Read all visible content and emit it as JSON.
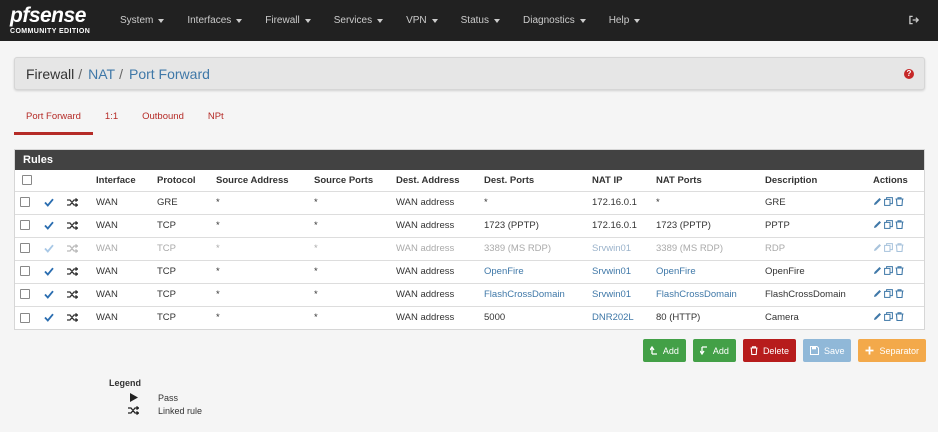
{
  "brand": {
    "top": "sense",
    "pf": "pf",
    "bottom": "COMMUNITY EDITION"
  },
  "nav": [
    "System",
    "Interfaces",
    "Firewall",
    "Services",
    "VPN",
    "Status",
    "Diagnostics",
    "Help"
  ],
  "breadcrumb": {
    "part1": "Firewall",
    "part2": "NAT",
    "part3": "Port Forward",
    "sep": "/"
  },
  "tabs": [
    "Port Forward",
    "1:1",
    "Outbound",
    "NPt"
  ],
  "rules": {
    "title": "Rules",
    "columns": [
      "Interface",
      "Protocol",
      "Source Address",
      "Source Ports",
      "Dest. Address",
      "Dest. Ports",
      "NAT IP",
      "NAT Ports",
      "Description",
      "Actions"
    ],
    "rows": [
      {
        "iface": "WAN",
        "proto": "GRE",
        "src": "*",
        "sport": "*",
        "dst": "WAN address",
        "dport": "*",
        "natip": "172.16.0.1",
        "natports": "*",
        "desc": "GRE",
        "enabled": true,
        "dport_link": false,
        "natip_link": false,
        "natports_link": false
      },
      {
        "iface": "WAN",
        "proto": "TCP",
        "src": "*",
        "sport": "*",
        "dst": "WAN address",
        "dport": "1723 (PPTP)",
        "natip": "172.16.0.1",
        "natports": "1723 (PPTP)",
        "desc": "PPTP",
        "enabled": true,
        "dport_link": false,
        "natip_link": false,
        "natports_link": false
      },
      {
        "iface": "WAN",
        "proto": "TCP",
        "src": "*",
        "sport": "*",
        "dst": "WAN address",
        "dport": "3389 (MS RDP)",
        "natip": "Srvwin01",
        "natports": "3389 (MS RDP)",
        "desc": "RDP",
        "enabled": false,
        "dport_link": false,
        "natip_link": true,
        "natports_link": false
      },
      {
        "iface": "WAN",
        "proto": "TCP",
        "src": "*",
        "sport": "*",
        "dst": "WAN address",
        "dport": "OpenFire",
        "natip": "Srvwin01",
        "natports": "OpenFire",
        "desc": "OpenFire",
        "enabled": true,
        "dport_link": true,
        "natip_link": true,
        "natports_link": true
      },
      {
        "iface": "WAN",
        "proto": "TCP",
        "src": "*",
        "sport": "*",
        "dst": "WAN address",
        "dport": "FlashCrossDomain",
        "natip": "Srvwin01",
        "natports": "FlashCrossDomain",
        "desc": "FlashCrossDomain",
        "enabled": true,
        "dport_link": true,
        "natip_link": true,
        "natports_link": true
      },
      {
        "iface": "WAN",
        "proto": "TCP",
        "src": "*",
        "sport": "*",
        "dst": "WAN address",
        "dport": "5000",
        "natip": "DNR202L",
        "natports": "80 (HTTP)",
        "desc": "Camera",
        "enabled": true,
        "dport_link": false,
        "natip_link": true,
        "natports_link": false
      }
    ]
  },
  "buttons": {
    "add_top": "Add",
    "add_bottom": "Add",
    "delete": "Delete",
    "save": "Save",
    "separator": "Separator"
  },
  "legend": {
    "title": "Legend",
    "pass": "Pass",
    "linked": "Linked rule"
  },
  "colors": {
    "navbar": "#212121",
    "accent_red": "#b52b27",
    "link": "#3f78a8",
    "check": "#2a6db0"
  }
}
